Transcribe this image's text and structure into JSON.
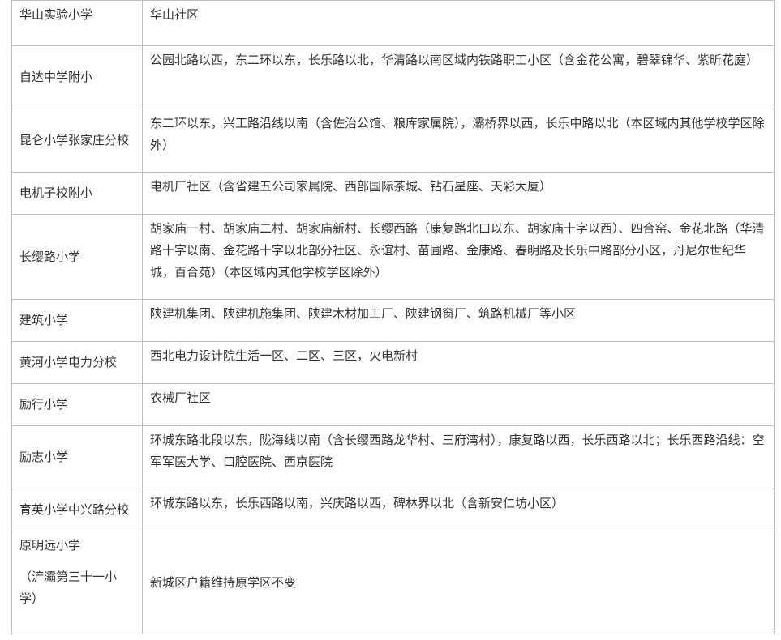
{
  "rows": [
    {
      "school": "华山实验小学",
      "district": "华山社区"
    },
    {
      "school": "自达中学附小",
      "district": "公园北路以西，东二环以东，长乐路以北，华清路以南区域内铁路职工小区（含金花公寓，碧翠锦华、紫昕花庭）"
    },
    {
      "school": "昆仑小学张家庄分校",
      "district": "东二环以东，兴工路沿线以南（含佐治公馆、粮库家属院），灞桥界以西，长乐中路以北（本区域内其他学校学区除外）"
    },
    {
      "school": "电机子校附小",
      "district": "电机厂社区（含省建五公司家属院、西部国际茶城、钻石星座、天彩大厦）"
    },
    {
      "school": "长缨路小学",
      "district": "胡家庙一村、胡家庙二村、胡家庙新村、长缨西路（康复路北口以东、胡家庙十字以西）、四合窑、金花北路（华清路十字以南、金花路十字以北部分社区、永谊村、苗圃路、金康路、春明路及长乐中路部分小区，丹尼尔世纪华城，百合苑）（本区域内其他学校学区除外）"
    },
    {
      "school": "建筑小学",
      "district": "陕建机集团、陕建机施集团、陕建木材加工厂、陕建钢窗厂、筑路机械厂等小区"
    },
    {
      "school": "黄河小学电力分校",
      "district": "西北电力设计院生活一区、二区、三区，火电新村"
    },
    {
      "school": "励行小学",
      "district": "农械厂社区"
    },
    {
      "school": "励志小学",
      "district": "环城东路北段以东，陇海线以南（含长缨西路龙华村、三府湾村），康复路以西，长乐西路以北；长乐西路沿线：空军军医大学、口腔医院、西京医院"
    },
    {
      "school": "育英小学中兴路分校",
      "district": "环城东路以东，长乐西路以南，兴庆路以西，碑林界以北（含新安仁坊小区）"
    },
    {
      "school": "原明远小学",
      "school_note": "（浐灞第三十一小学）",
      "district": "新城区户籍维持原学区不变"
    }
  ]
}
